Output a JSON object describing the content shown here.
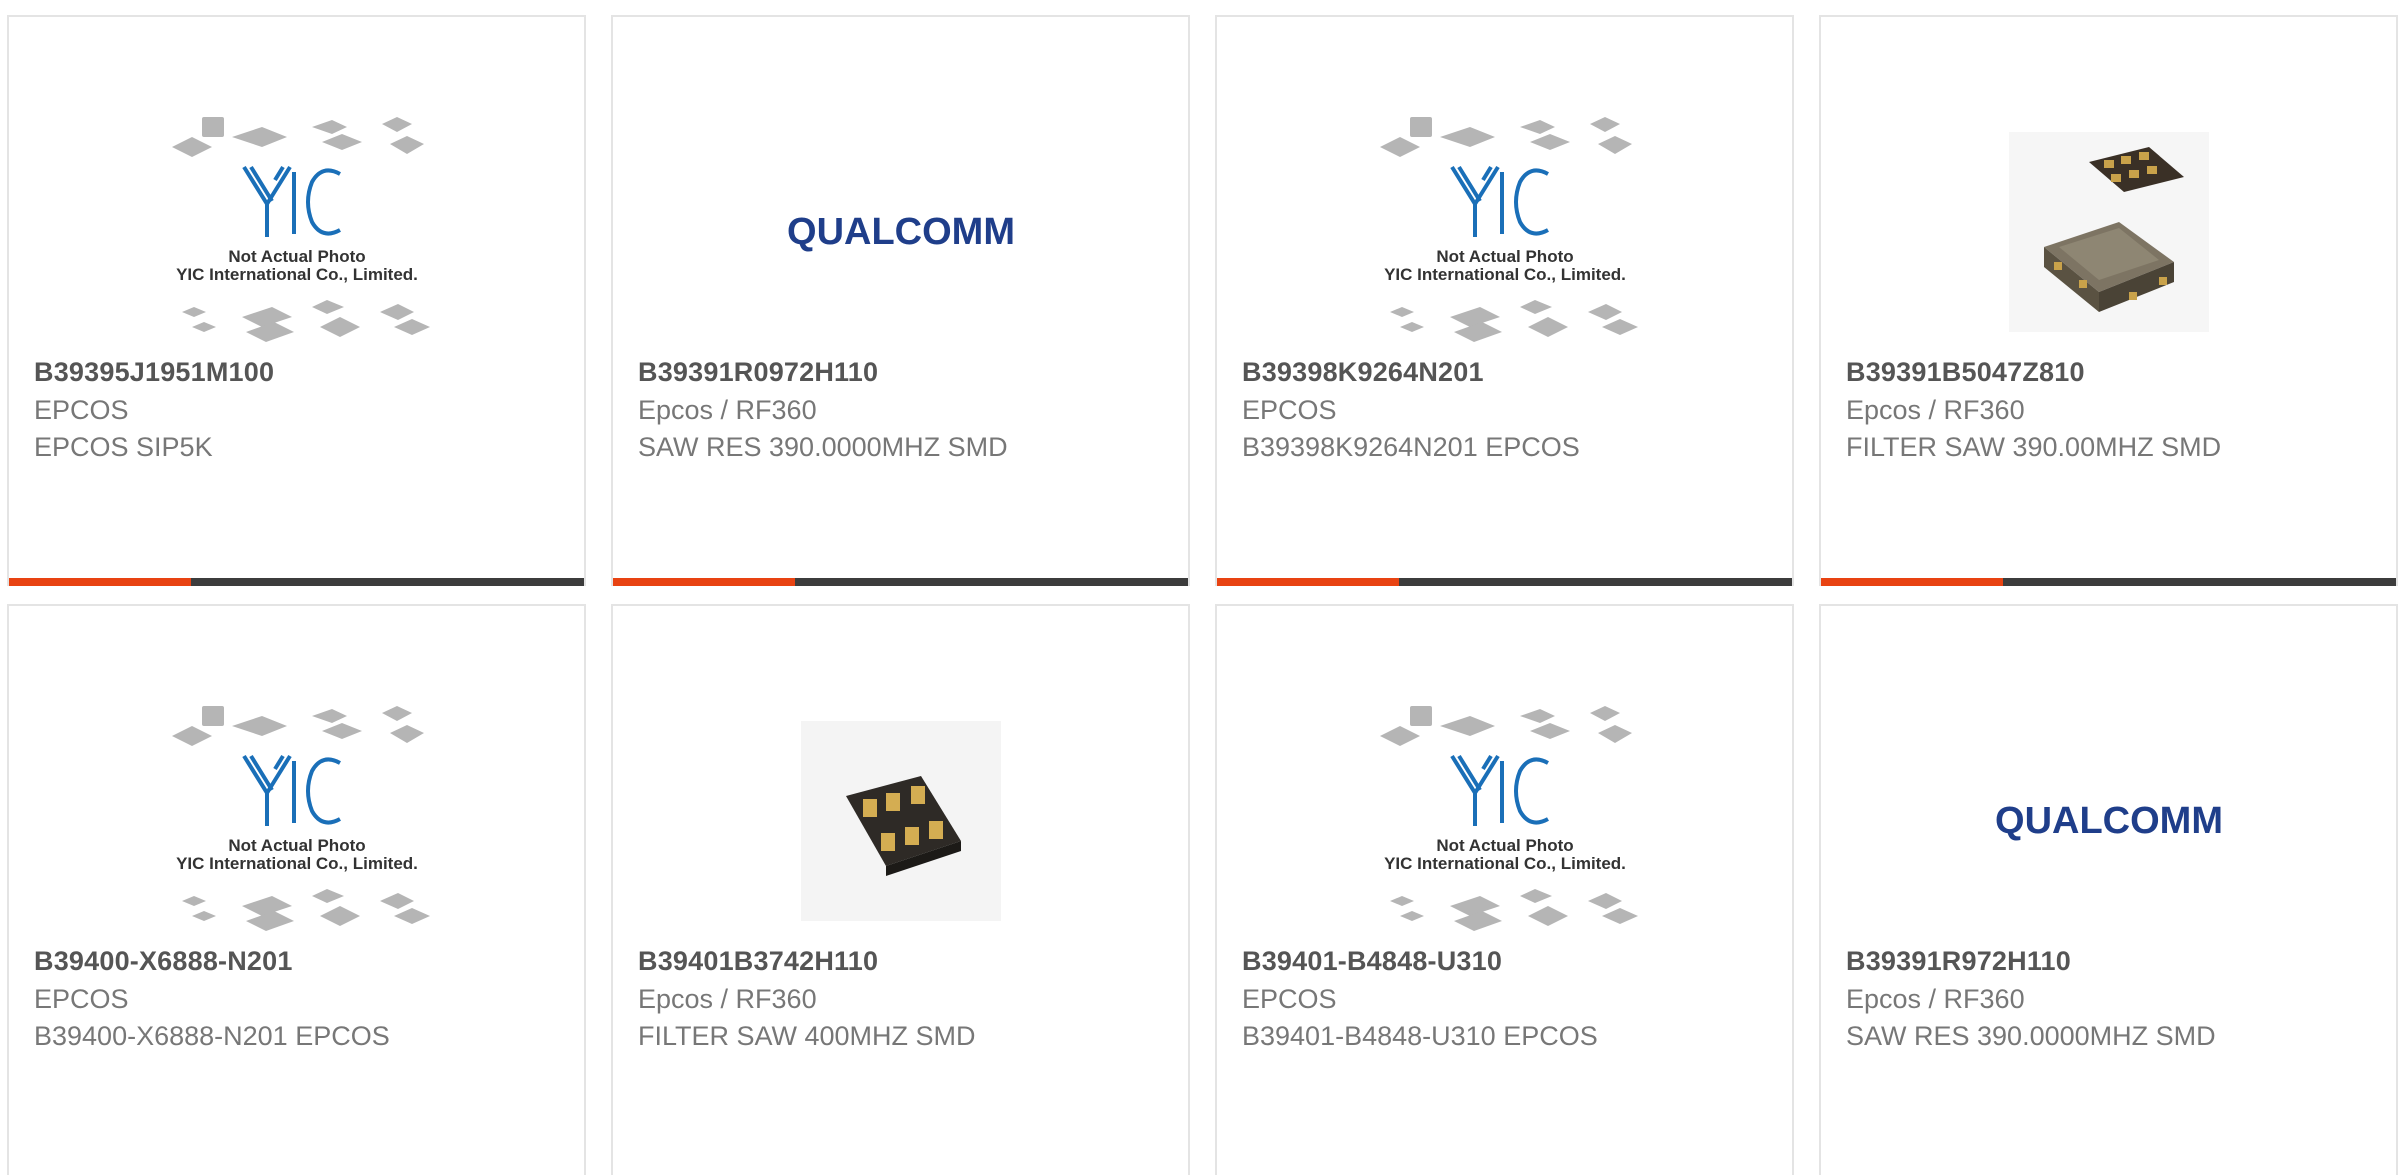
{
  "cards": [
    {
      "part_number": "B39395J1951M100",
      "manufacturer": "EPCOS",
      "description": "EPCOS SIP5K",
      "image": "yic-placeholder",
      "placeholder_logo": "YIC",
      "placeholder_line1": "Not Actual Photo",
      "placeholder_line2": "YIC International Co., Limited."
    },
    {
      "part_number": "B39391R0972H110",
      "manufacturer": "Epcos / RF360",
      "description": "SAW RES 390.0000MHZ SMD",
      "image": "qualcomm-logo",
      "logo_text": "QUALCOMM"
    },
    {
      "part_number": "B39398K9264N201",
      "manufacturer": "EPCOS",
      "description": "B39398K9264N201 EPCOS",
      "image": "yic-placeholder",
      "placeholder_logo": "YIC",
      "placeholder_line1": "Not Actual Photo",
      "placeholder_line2": "YIC International Co., Limited."
    },
    {
      "part_number": "B39391B5047Z810",
      "manufacturer": "Epcos / RF360",
      "description": "FILTER SAW 390.00MHZ SMD",
      "image": "saw-filter-photo-two-packages"
    },
    {
      "part_number": "B39400-X6888-N201",
      "manufacturer": "EPCOS",
      "description": "B39400-X6888-N201 EPCOS",
      "image": "yic-placeholder",
      "placeholder_logo": "YIC",
      "placeholder_line1": "Not Actual Photo",
      "placeholder_line2": "YIC International Co., Limited."
    },
    {
      "part_number": "B39401B3742H110",
      "manufacturer": "Epcos / RF360",
      "description": "FILTER SAW 400MHZ SMD",
      "image": "saw-filter-photo-single-package"
    },
    {
      "part_number": "B39401-B4848-U310",
      "manufacturer": "EPCOS",
      "description": "B39401-B4848-U310 EPCOS",
      "image": "yic-placeholder",
      "placeholder_logo": "YIC",
      "placeholder_line1": "Not Actual Photo",
      "placeholder_line2": "YIC International Co., Limited."
    },
    {
      "part_number": "B39391R972H110",
      "manufacturer": "Epcos / RF360",
      "description": "SAW RES 390.0000MHZ SMD",
      "image": "qualcomm-logo",
      "logo_text": "QUALCOMM"
    }
  ],
  "colors": {
    "accent": "#e84312",
    "bar": "#3c3c3c",
    "part_number": "#555555",
    "text": "#777777",
    "qualcomm_blue": "#1f3e8a",
    "yic_blue": "#1a6fb8"
  }
}
